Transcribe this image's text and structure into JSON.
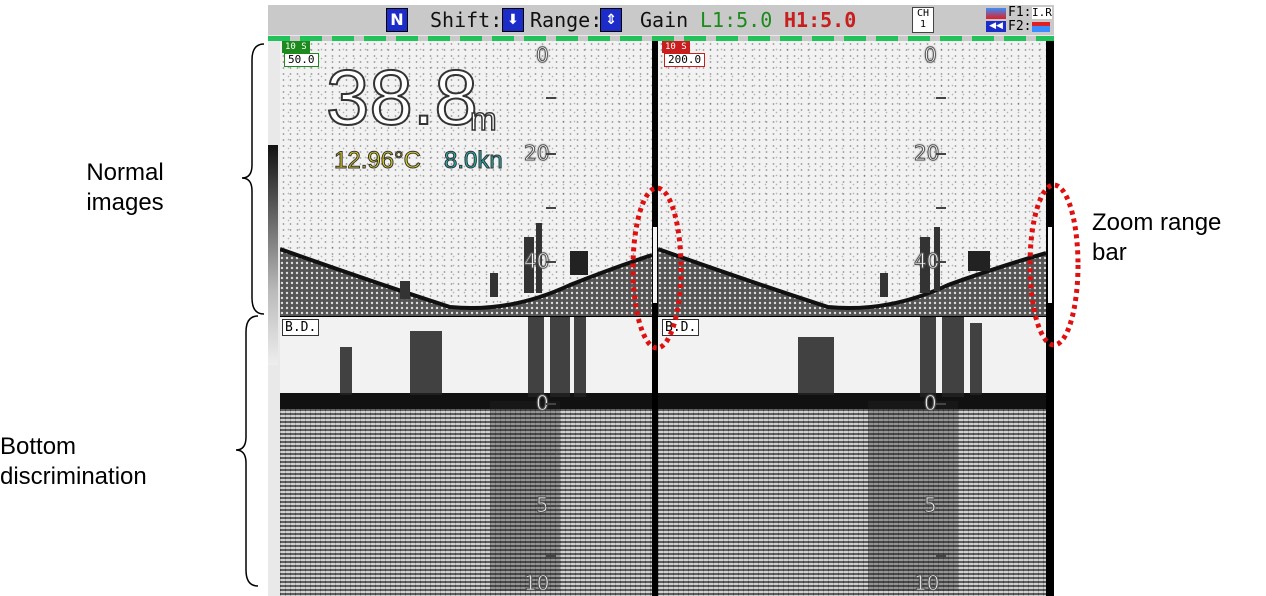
{
  "annotations": {
    "normal": "Normal\nimages",
    "bottom": "Bottom\ndiscrimination",
    "zoom": "Zoom range\nbar"
  },
  "topbar": {
    "mode": "N",
    "shift_label": "Shift:",
    "range_label": "Range:",
    "gain_label": "Gain",
    "gain_low": "L1:5.0",
    "gain_high": "H1:5.0",
    "ch_label": "CH\n1",
    "f1_label": "F1:",
    "f1_value": "I.R",
    "f2_label": "F2:"
  },
  "left_panel": {
    "interval": "10 S",
    "frequency": "50.0",
    "depth": "38.8",
    "depth_unit": "m",
    "temperature": "12.96°C",
    "speed": "8.0kn",
    "scale": [
      "0",
      "20",
      "40"
    ],
    "bd_label": "B.D.",
    "bd_scale": [
      "0",
      "5",
      "10"
    ]
  },
  "right_panel": {
    "interval": "10 S",
    "frequency": "200.0",
    "scale": [
      "0",
      "20",
      "40"
    ],
    "bd_label": "B.D.",
    "bd_scale": [
      "0",
      "5",
      "10"
    ]
  },
  "colors": {
    "gain_low": "#1c8a1c",
    "gain_high": "#c81e1e",
    "mode_box": "#1b2cc8",
    "dash": "#22c25a",
    "zoom_ring": "#e01010",
    "temperature": "#e0d21e",
    "speed": "#1fb6b6"
  }
}
